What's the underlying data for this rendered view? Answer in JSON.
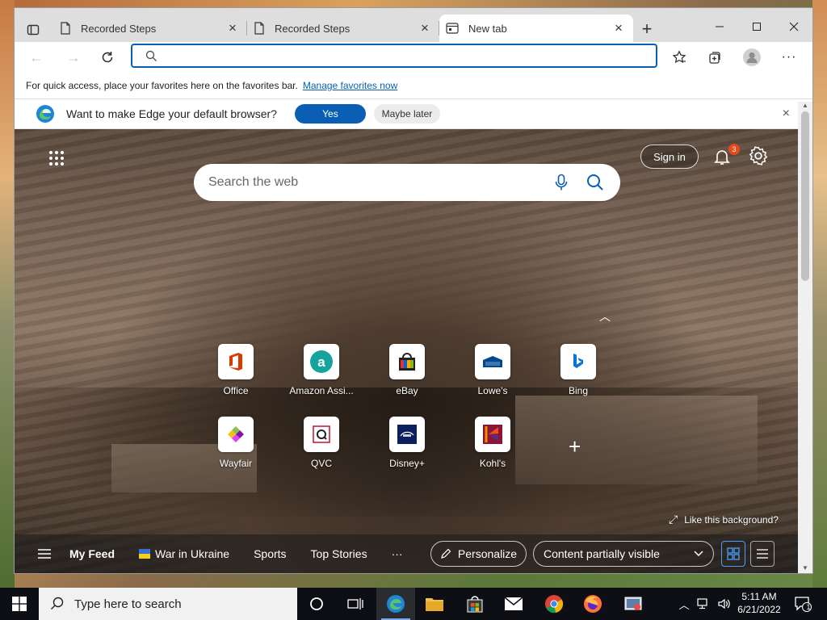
{
  "tabs": [
    {
      "title": "Recorded Steps"
    },
    {
      "title": "Recorded Steps"
    },
    {
      "title": "New tab"
    }
  ],
  "address": {
    "value": "",
    "placeholder": ""
  },
  "favorites_bar": {
    "message": "For quick access, place your favorites here on the favorites bar.",
    "link": "Manage favorites now"
  },
  "default_prompt": {
    "question": "Want to make Edge your default browser?",
    "yes": "Yes",
    "later": "Maybe later"
  },
  "ntp": {
    "signin": "Sign in",
    "notifications_count": "3",
    "search_placeholder": "Search the web",
    "like_background": "Like this background?",
    "quick_links": [
      {
        "label": "Office",
        "icon": "office-icon",
        "color": "#d83b01"
      },
      {
        "label": "Amazon Assi...",
        "icon": "amazon-assistant-icon",
        "color": "#16a39e"
      },
      {
        "label": "eBay",
        "icon": "ebay-icon",
        "color": "#e53238"
      },
      {
        "label": "Lowe's",
        "icon": "lowes-icon",
        "color": "#004990"
      },
      {
        "label": "Bing",
        "icon": "bing-icon",
        "color": "#0a73d8"
      },
      {
        "label": "Wayfair",
        "icon": "wayfair-icon",
        "color": "#7b189f"
      },
      {
        "label": "QVC",
        "icon": "qvc-icon",
        "color": "#c8102e"
      },
      {
        "label": "Disney+",
        "icon": "disney-plus-icon",
        "color": "#0b1f5c"
      },
      {
        "label": "Kohl's",
        "icon": "kohls-icon",
        "color": "#8a1538"
      }
    ],
    "feed": {
      "items": [
        "My Feed",
        "War in Ukraine",
        "Sports",
        "Top Stories"
      ],
      "more": "···",
      "personalize": "Personalize",
      "content_visibility": "Content partially visible"
    }
  },
  "taskbar": {
    "search_placeholder": "Type here to search",
    "time": "5:11 AM",
    "date": "6/21/2022",
    "notification_count": "1"
  }
}
